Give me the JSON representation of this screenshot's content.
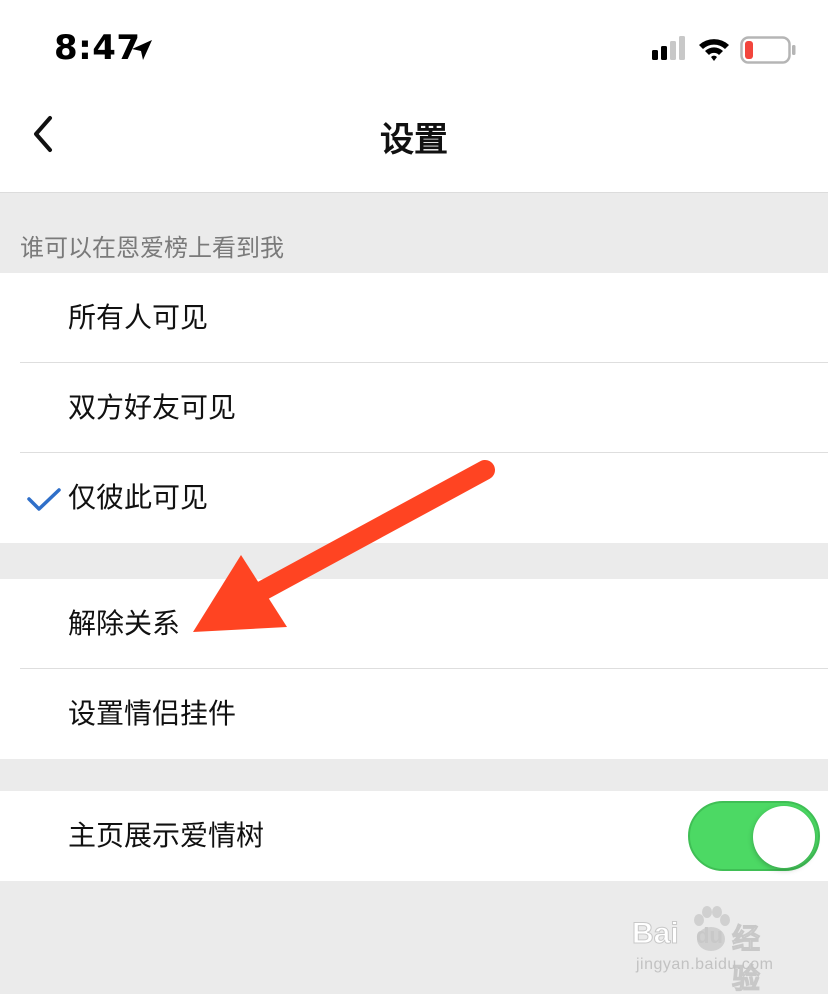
{
  "status_bar": {
    "time": "8:47",
    "icons": [
      "location-arrow-icon",
      "cellular-signal-icon",
      "wifi-icon",
      "battery-low-icon"
    ],
    "battery_color": "#f2453d"
  },
  "nav": {
    "back_icon": "chevron-left-icon",
    "title": "设置"
  },
  "visibility_section": {
    "header": "谁可以在恩爱榜上看到我",
    "options": [
      {
        "label": "所有人可见",
        "selected": false
      },
      {
        "label": "双方好友可见",
        "selected": false
      },
      {
        "label": "仅彼此可见",
        "selected": true
      }
    ],
    "check_color": "#2f6fc9"
  },
  "relationship_section": {
    "items": [
      {
        "label": "解除关系"
      },
      {
        "label": "设置情侣挂件"
      }
    ]
  },
  "tree_section": {
    "label": "主页展示爱情树",
    "toggle_on": true,
    "toggle_color": "#4cd964"
  },
  "annotation": {
    "arrow_color": "#ff4422",
    "points_to": "解除关系"
  },
  "watermark": {
    "brand_left": "Bai",
    "brand_paw_text": "du",
    "brand_right": "经验",
    "url": "jingyan.baidu.com"
  }
}
